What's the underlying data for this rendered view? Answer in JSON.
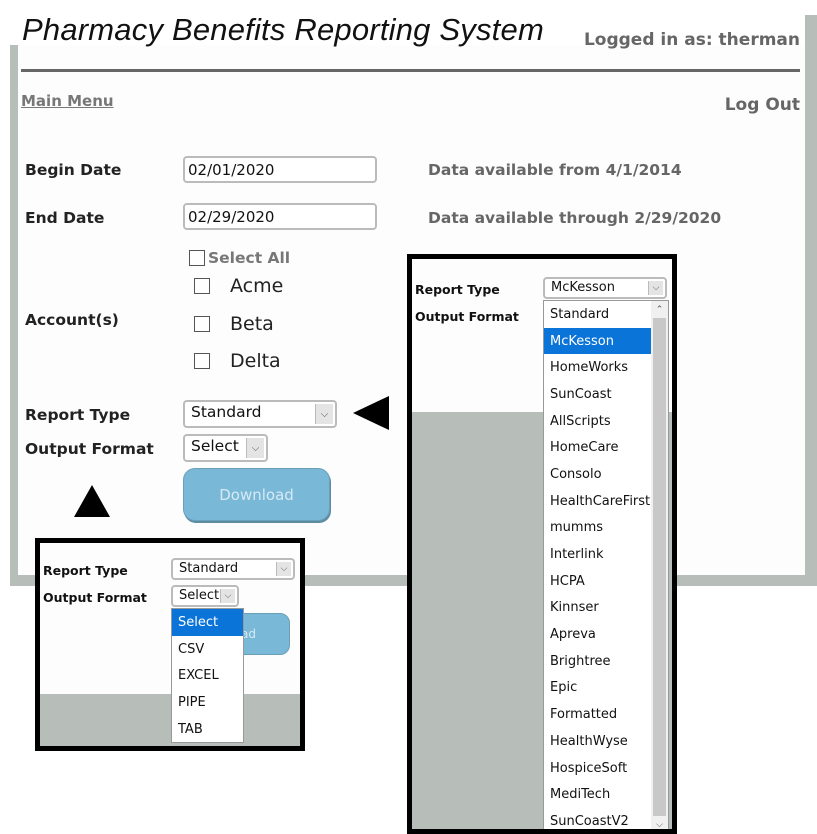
{
  "header": {
    "title": "Pharmacy Benefits Reporting System",
    "logged_in": "Logged in as: therman",
    "main_menu": "Main Menu",
    "logout": "Log Out"
  },
  "form": {
    "begin_date": {
      "label": "Begin Date",
      "value": "02/01/2020",
      "note": "Data available from 4/1/2014"
    },
    "end_date": {
      "label": "End Date",
      "value": "02/29/2020",
      "note": "Data available through 2/29/2020"
    },
    "accounts": {
      "label": "Account(s)",
      "select_all": "Select All",
      "items": [
        {
          "label": "Acme",
          "checked": false
        },
        {
          "label": "Beta",
          "checked": false
        },
        {
          "label": "Delta",
          "checked": false
        }
      ]
    },
    "report_type": {
      "label": "Report Type",
      "value": "Standard"
    },
    "output_format": {
      "label": "Output Format",
      "value": "Select"
    },
    "download": "Download"
  },
  "inset_output_format": {
    "report_type_label": "Report Type",
    "report_type_value": "Standard",
    "output_format_label": "Output Format",
    "output_format_value": "Select",
    "download_partial": "ad",
    "options": [
      "Select",
      "CSV",
      "EXCEL",
      "PIPE",
      "TAB"
    ],
    "selected": "Select"
  },
  "inset_report_type": {
    "report_type_label": "Report Type",
    "report_type_value": "McKesson",
    "output_format_label": "Output Format",
    "options": [
      "Standard",
      "McKesson",
      "HomeWorks",
      "SunCoast",
      "AllScripts",
      "HomeCare",
      "Consolo",
      "HealthCareFirst",
      "mumms",
      "Interlink",
      "HCPA",
      "Kinnser",
      "Apreva",
      "Brightree",
      "Epic",
      "Formatted",
      "HealthWyse",
      "HospiceSoft",
      "MediTech",
      "SunCoastV2"
    ],
    "selected": "McKesson"
  },
  "icons": {
    "chevron_down": "⌵",
    "chevron_up": "⌃"
  }
}
